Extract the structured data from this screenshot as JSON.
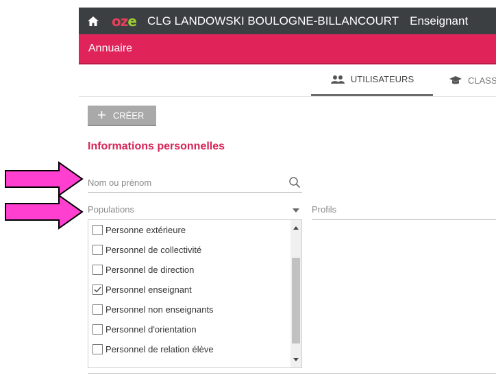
{
  "topbar": {
    "logo_o": "o",
    "logo_z": "z",
    "logo_e": "e",
    "school": "CLG LANDOWSKI BOULOGNE-BILLANCOURT",
    "role": "Enseignant"
  },
  "subbar": {
    "title": "Annuaire"
  },
  "tabs": [
    {
      "label": "UTILISATEURS",
      "icon": "users-icon"
    },
    {
      "label": "CLASS",
      "icon": "graduation-cap-icon"
    }
  ],
  "create_button": {
    "label": "CRÉER"
  },
  "section": {
    "title": "Informations personnelles"
  },
  "search": {
    "placeholder": "Nom ou prénom"
  },
  "populations": {
    "placeholder": "Populations"
  },
  "profils": {
    "placeholder": "Profils"
  },
  "populations_list": [
    {
      "label": "Personne extérieure",
      "checked": false
    },
    {
      "label": "Personnel de collectivité",
      "checked": false
    },
    {
      "label": "Personnel de direction",
      "checked": false
    },
    {
      "label": "Personnel enseignant",
      "checked": true
    },
    {
      "label": "Personnel non enseignants",
      "checked": false
    },
    {
      "label": "Personnel d'orientation",
      "checked": false
    },
    {
      "label": "Personnel de relation élève",
      "checked": false
    }
  ],
  "colors": {
    "accent": "#e0245a",
    "topbar": "#3c3f42",
    "arrow": "#ff3fd0"
  }
}
